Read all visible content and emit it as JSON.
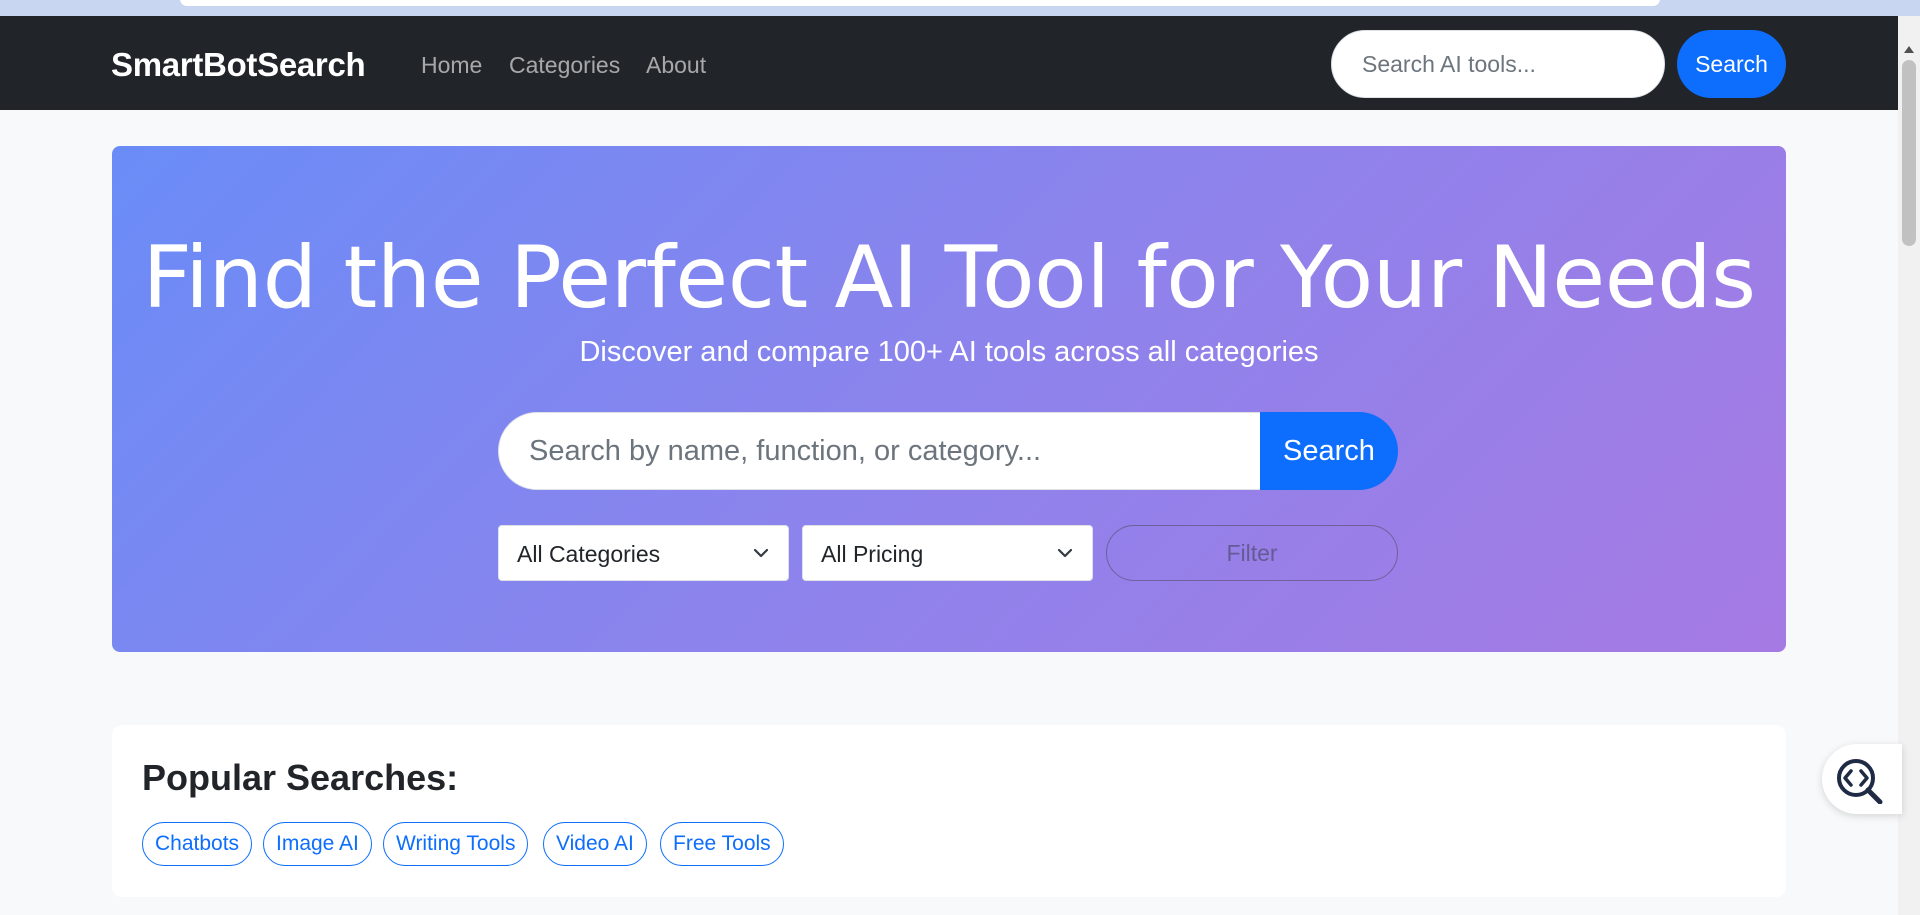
{
  "navbar": {
    "brand": "SmartBotSearch",
    "links": [
      "Home",
      "Categories",
      "About"
    ],
    "search_placeholder": "Search AI tools...",
    "search_button": "Search"
  },
  "hero": {
    "title": "Find the Perfect AI Tool for Your Needs",
    "subtitle": "Discover and compare 100+ AI tools across all categories",
    "search_placeholder": "Search by name, function, or category...",
    "search_button": "Search",
    "category_select": "All Categories",
    "pricing_select": "All Pricing",
    "filter_button": "Filter"
  },
  "popular": {
    "title": "Popular Searches:",
    "tags": [
      "Chatbots",
      "Image AI",
      "Writing Tools",
      "Video AI",
      "Free Tools"
    ]
  },
  "icons": {
    "chevron": "chevron-down-icon",
    "fab": "code-search-icon"
  },
  "colors": {
    "primary": "#0d6efd",
    "navbar": "#212529",
    "hero_start": "#6a8cf7",
    "hero_end": "#a67ae3"
  }
}
